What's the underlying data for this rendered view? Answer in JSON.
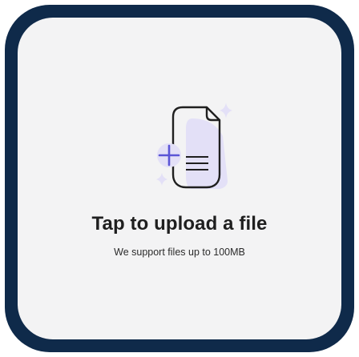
{
  "upload": {
    "title": "Tap to upload a file",
    "subtitle": "We support files up to 100MB"
  },
  "colors": {
    "frame": "#0f2a4a",
    "card": "#f3f3f4",
    "accent": "#5b55d6",
    "soft_accent": "#e3e0f7"
  },
  "icons": {
    "main": "file-upload-icon",
    "plus": "plus-icon",
    "sparkles": "sparkle-icon"
  }
}
